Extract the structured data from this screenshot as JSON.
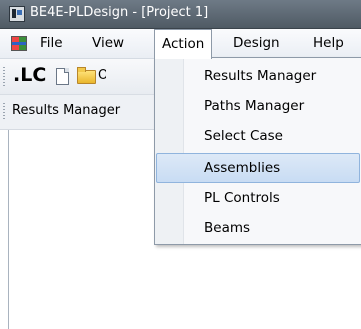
{
  "window": {
    "title": "BE4E-PLDesign - [Project 1]"
  },
  "menubar": {
    "items": [
      {
        "label": "File"
      },
      {
        "label": "View"
      },
      {
        "label": "Action"
      },
      {
        "label": "Design"
      },
      {
        "label": "Help"
      }
    ]
  },
  "toolbar": {
    "lc_label": ".LC",
    "open_label": "Op"
  },
  "tabstrip": {
    "label": "Results Manager"
  },
  "action_menu": {
    "items": [
      {
        "label": "Results Manager"
      },
      {
        "label": "Paths Manager"
      },
      {
        "label": "Select Case"
      },
      {
        "label": "Assemblies",
        "highlighted": true
      },
      {
        "label": "PL Controls"
      },
      {
        "label": "Beams"
      }
    ]
  },
  "colors": {
    "highlight": "#c8dcf3",
    "highlight_border": "#90b4dd",
    "titlebar": "#4f5a64"
  }
}
